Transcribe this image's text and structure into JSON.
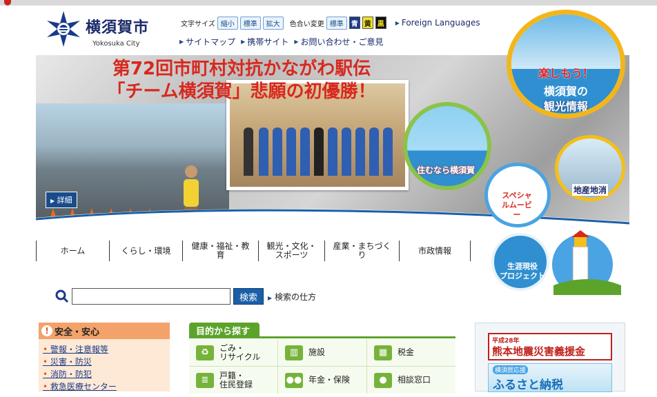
{
  "header": {
    "logo_title": "横須賀市",
    "logo_sub": "Yokosuka City",
    "font_size_label": "文字サイズ",
    "font_buttons": [
      "縮小",
      "標準",
      "拡大"
    ],
    "color_label": "色合い変更",
    "color_standard": "標準",
    "color_buttons": [
      {
        "label": "青",
        "bg": "#1a3a8a",
        "fg": "#ffffff"
      },
      {
        "label": "黄",
        "bg": "#f3e21a",
        "fg": "#222222"
      },
      {
        "label": "黒",
        "bg": "#111111",
        "fg": "#f3e21a"
      }
    ],
    "foreign": "Foreign Languages",
    "links": [
      "サイトマップ",
      "携帯サイト",
      "お問い合わせ・ご意見"
    ]
  },
  "hero": {
    "title_line1": "第72回市町村対抗かながわ駅伝",
    "title_line2": "「チーム横須賀」悲願の初優勝！",
    "detail": "詳細",
    "tourism": {
      "line1": "楽しもう！",
      "line2": "横須賀の",
      "line3": "観光情報"
    },
    "live": "住むなら横須賀",
    "local": "地産地消",
    "movie": "スペシャルムービー"
  },
  "nav": {
    "items": [
      "ホーム",
      "くらし・環境",
      "健康・福祉・教育",
      "観光・文化・\nスポーツ",
      "産業・まちづくり",
      "市政情報"
    ]
  },
  "lifelong": "生涯現役\nプロジェクト",
  "search": {
    "value": "",
    "button": "検索",
    "howto": "検索の仕方"
  },
  "safety": {
    "title": "安全・安心",
    "items": [
      "警報・注意報等",
      "災害・防災",
      "消防・防犯",
      "救急医療センター"
    ]
  },
  "purpose": {
    "title": "目的から探す",
    "cells": [
      {
        "label": "ごみ・\nリサイクル",
        "icon": "recycle-icon"
      },
      {
        "label": "施設",
        "icon": "building-icon"
      },
      {
        "label": "税金",
        "icon": "calculator-icon"
      },
      {
        "label": "戸籍・\n住民登録",
        "icon": "document-icon"
      },
      {
        "label": "年金・保険",
        "icon": "people-icon"
      },
      {
        "label": "相談窓口",
        "icon": "person-icon"
      }
    ]
  },
  "banner": {
    "year": "平成28年",
    "kumamoto": "熊本地震災害義援金",
    "support": "横須賀応援",
    "furusato": "ふるさと納税"
  }
}
